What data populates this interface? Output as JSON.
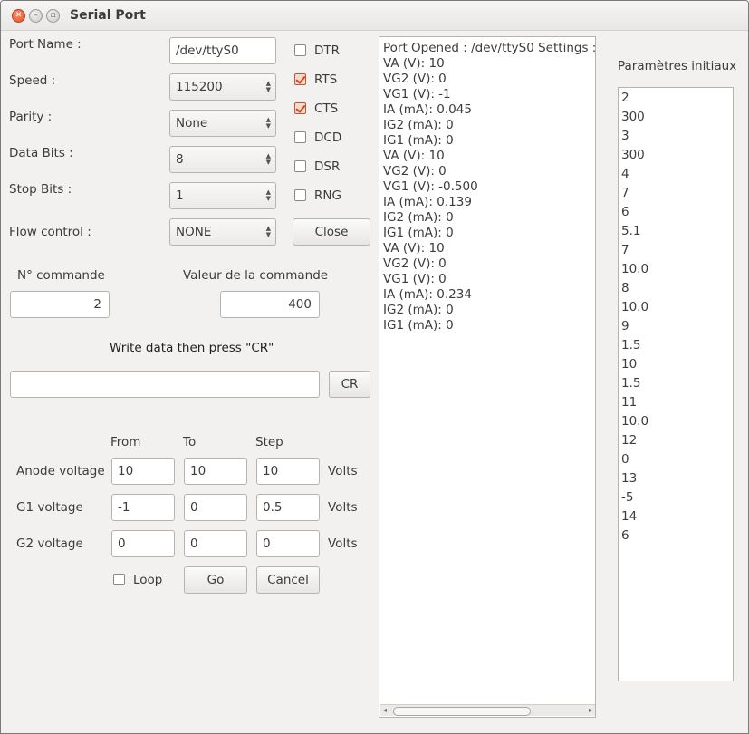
{
  "window": {
    "title": "Serial Port"
  },
  "port": {
    "port_name_label": "Port Name :",
    "port_name_value": "/dev/ttyS0",
    "speed_label": "Speed :",
    "speed_value": "115200",
    "parity_label": "Parity :",
    "parity_value": "None",
    "data_bits_label": "Data Bits :",
    "data_bits_value": "8",
    "stop_bits_label": "Stop Bits :",
    "stop_bits_value": "1",
    "flow_label": "Flow control :",
    "flow_value": "NONE",
    "close_label": "Close"
  },
  "signals": [
    {
      "label": "DTR",
      "checked": false
    },
    {
      "label": "RTS",
      "checked": true
    },
    {
      "label": "CTS",
      "checked": true
    },
    {
      "label": "DCD",
      "checked": false
    },
    {
      "label": "DSR",
      "checked": false
    },
    {
      "label": "RNG",
      "checked": false
    }
  ],
  "command": {
    "num_label": "N° commande",
    "num_value": "2",
    "value_label": "Valeur de la commande",
    "value_value": "400"
  },
  "write": {
    "label": "Write data then press \"CR\"",
    "value": "",
    "cr_label": "CR"
  },
  "sweep": {
    "from_label": "From",
    "to_label": "To",
    "step_label": "Step",
    "rows": [
      {
        "label": "Anode voltage",
        "from": "10",
        "to": "10",
        "step": "10",
        "unit": "Volts"
      },
      {
        "label": "G1 voltage",
        "from": "-1",
        "to": "0",
        "step": "0.5",
        "unit": "Volts"
      },
      {
        "label": "G2 voltage",
        "from": "0",
        "to": "0",
        "step": "0",
        "unit": "Volts"
      }
    ],
    "loop_label": "Loop",
    "go_label": "Go",
    "cancel_label": "Cancel"
  },
  "log": {
    "lines": [
      "Port Opened : /dev/ttyS0 Settings :",
      "VA (V): 10",
      "VG2 (V): 0",
      "VG1 (V): -1",
      "IA (mA): 0.045",
      "IG2 (mA): 0",
      "IG1 (mA): 0",
      "VA (V): 10",
      "VG2 (V): 0",
      "VG1 (V): -0.500",
      "IA (mA): 0.139",
      "IG2 (mA): 0",
      "IG1 (mA): 0",
      "VA (V): 10",
      "VG2 (V): 0",
      "VG1 (V): 0",
      "IA (mA): 0.234",
      "IG2 (mA): 0",
      "IG1 (mA): 0"
    ]
  },
  "params": {
    "title": "Paramètres initiaux",
    "items": [
      "2",
      "300",
      "3",
      "300",
      "4",
      "7",
      "6",
      "5.1",
      "7",
      "10.0",
      "8",
      "10.0",
      "9",
      "1.5",
      "10",
      "1.5",
      "11",
      "10.0",
      "12",
      "0",
      "13",
      "-5",
      "14",
      "6"
    ]
  }
}
